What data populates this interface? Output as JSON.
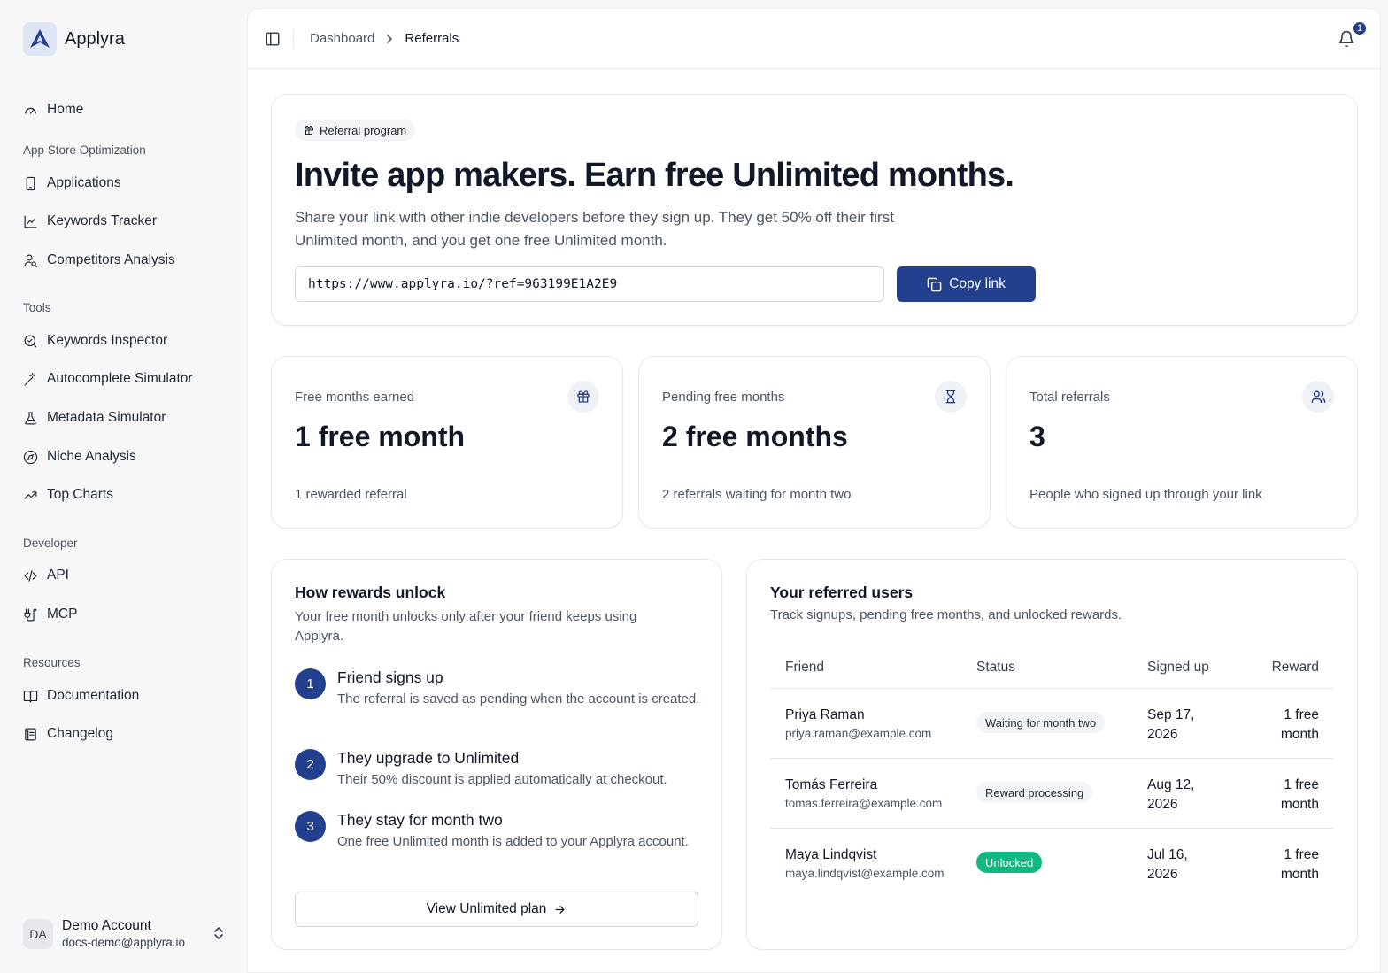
{
  "app": {
    "name": "Applyra"
  },
  "sidebar": {
    "home": "Home",
    "sections": {
      "aso": "App Store Optimization",
      "tools": "Tools",
      "developer": "Developer",
      "resources": "Resources"
    },
    "items": {
      "applications": "Applications",
      "keywords_tracker": "Keywords Tracker",
      "competitors_analysis": "Competitors Analysis",
      "keywords_inspector": "Keywords Inspector",
      "autocomplete_simulator": "Autocomplete Simulator",
      "metadata_simulator": "Metadata Simulator",
      "niche_analysis": "Niche Analysis",
      "top_charts": "Top Charts",
      "api": "API",
      "mcp": "MCP",
      "documentation": "Documentation",
      "changelog": "Changelog"
    },
    "account": {
      "initials": "DA",
      "name": "Demo Account",
      "email": "docs-demo@applyra.io"
    }
  },
  "header": {
    "breadcrumb": [
      "Dashboard",
      "Referrals"
    ],
    "notification_count": "1"
  },
  "hero": {
    "pill": "Referral program",
    "title": "Invite app makers. Earn free Unlimited months.",
    "description": "Share your link with other indie developers before they sign up. They get 50% off their first Unlimited month, and you get one free Unlimited month.",
    "link_value": "https://www.applyra.io/?ref=963199E1A2E9",
    "copy_label": "Copy link"
  },
  "stats": [
    {
      "label": "Free months earned",
      "value": "1 free month",
      "sub": "1 rewarded referral",
      "icon": "gift-icon"
    },
    {
      "label": "Pending free months",
      "value": "2 free months",
      "sub": "2 referrals waiting for month two",
      "icon": "hourglass-icon"
    },
    {
      "label": "Total referrals",
      "value": "3",
      "sub": "People who signed up through your link",
      "icon": "users-icon"
    }
  ],
  "how": {
    "title": "How rewards unlock",
    "description": "Your free month unlocks only after your friend keeps using Applyra.",
    "steps": [
      {
        "num": "1",
        "title": "Friend signs up",
        "desc": "The referral is saved as pending when the account is created."
      },
      {
        "num": "2",
        "title": "They upgrade to Unlimited",
        "desc": "Their 50% discount is applied automatically at checkout."
      },
      {
        "num": "3",
        "title": "They stay for month two",
        "desc": "One free Unlimited month is added to your Applyra account."
      }
    ],
    "button": "View Unlimited plan"
  },
  "referred": {
    "title": "Your referred users",
    "description": "Track signups, pending free months, and unlocked rewards.",
    "columns": [
      "Friend",
      "Status",
      "Signed up",
      "Reward"
    ],
    "rows": [
      {
        "name": "Priya Raman",
        "email": "priya.raman@example.com",
        "status": "Waiting for month two",
        "signed_up": "Sep 17, 2026",
        "reward": "1 free month"
      },
      {
        "name": "Tomás Ferreira",
        "email": "tomas.ferreira@example.com",
        "status": "Reward processing",
        "signed_up": "Aug 12, 2026",
        "reward": "1 free month"
      },
      {
        "name": "Maya Lindqvist",
        "email": "maya.lindqvist@example.com",
        "status": "Unlocked",
        "signed_up": "Jul 16, 2026",
        "reward": "1 free month"
      }
    ]
  },
  "colors": {
    "accent": "#23408e",
    "success": "#10b981"
  }
}
